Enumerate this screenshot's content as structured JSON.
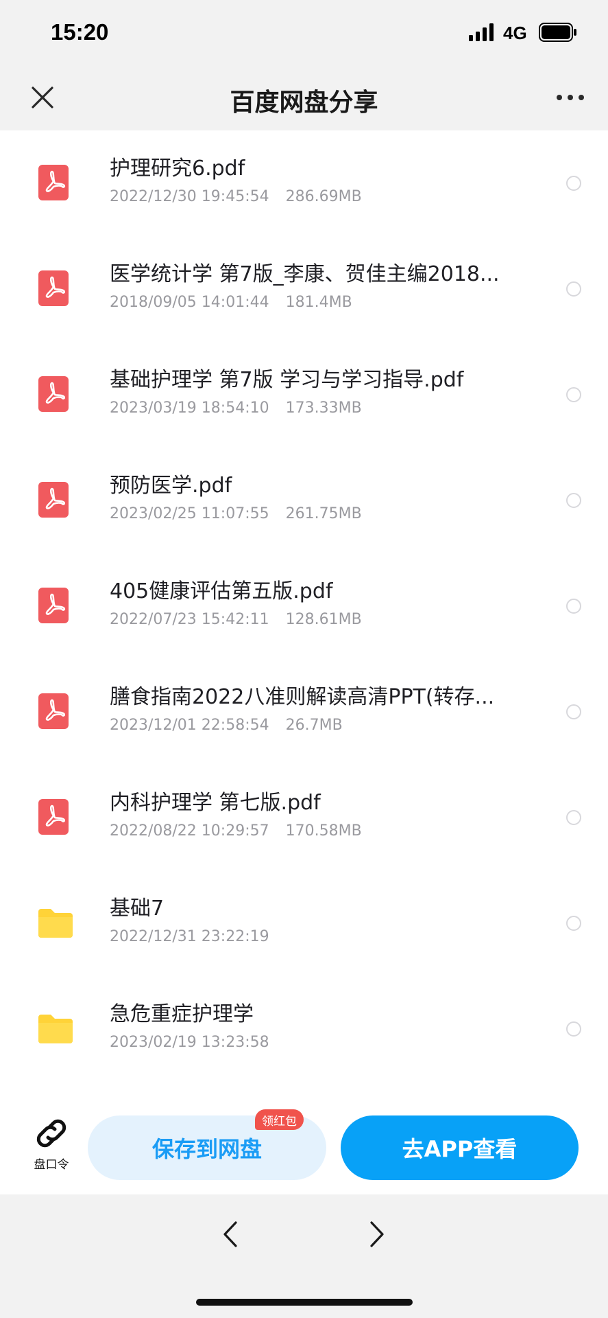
{
  "status_bar": {
    "time": "15:20",
    "network": "4G"
  },
  "nav": {
    "title": "百度网盘分享"
  },
  "files": [
    {
      "name": "护理研究6.pdf",
      "date": "2022/12/30 19:45:54",
      "size": "286.69MB",
      "type": "pdf"
    },
    {
      "name": "医学统计学 第7版_李康、贺佳主编2018...",
      "date": "2018/09/05 14:01:44",
      "size": "181.4MB",
      "type": "pdf"
    },
    {
      "name": "基础护理学 第7版 学习与学习指导.pdf",
      "date": "2023/03/19 18:54:10",
      "size": "173.33MB",
      "type": "pdf"
    },
    {
      "name": "预防医学.pdf",
      "date": "2023/02/25 11:07:55",
      "size": "261.75MB",
      "type": "pdf"
    },
    {
      "name": "405健康评估第五版.pdf",
      "date": "2022/07/23 15:42:11",
      "size": "128.61MB",
      "type": "pdf"
    },
    {
      "name": "膳食指南2022八准则解读高清PPT(转存...",
      "date": "2023/12/01 22:58:54",
      "size": "26.7MB",
      "type": "pdf"
    },
    {
      "name": "内科护理学 第七版.pdf",
      "date": "2022/08/22 10:29:57",
      "size": "170.58MB",
      "type": "pdf"
    },
    {
      "name": "基础7",
      "date": "2022/12/31 23:22:19",
      "size": "",
      "type": "folder"
    },
    {
      "name": "急危重症护理学",
      "date": "2023/02/19 13:23:58",
      "size": "",
      "type": "folder"
    }
  ],
  "actions": {
    "link_label": "盘口令",
    "save_label": "保存到网盘",
    "badge_label": "领红包",
    "app_label": "去APP查看"
  },
  "colors": {
    "pdf_red": "#f05a5e",
    "folder_yellow": "#ffd338",
    "primary_blue": "#08a1f7",
    "badge_red": "#f0534c"
  },
  "icons": {
    "close": "close-icon",
    "more": "more-icon",
    "pdf": "pdf-file-icon",
    "folder": "folder-icon",
    "link": "link-icon",
    "back": "chevron-left-icon",
    "forward": "chevron-right-icon"
  }
}
